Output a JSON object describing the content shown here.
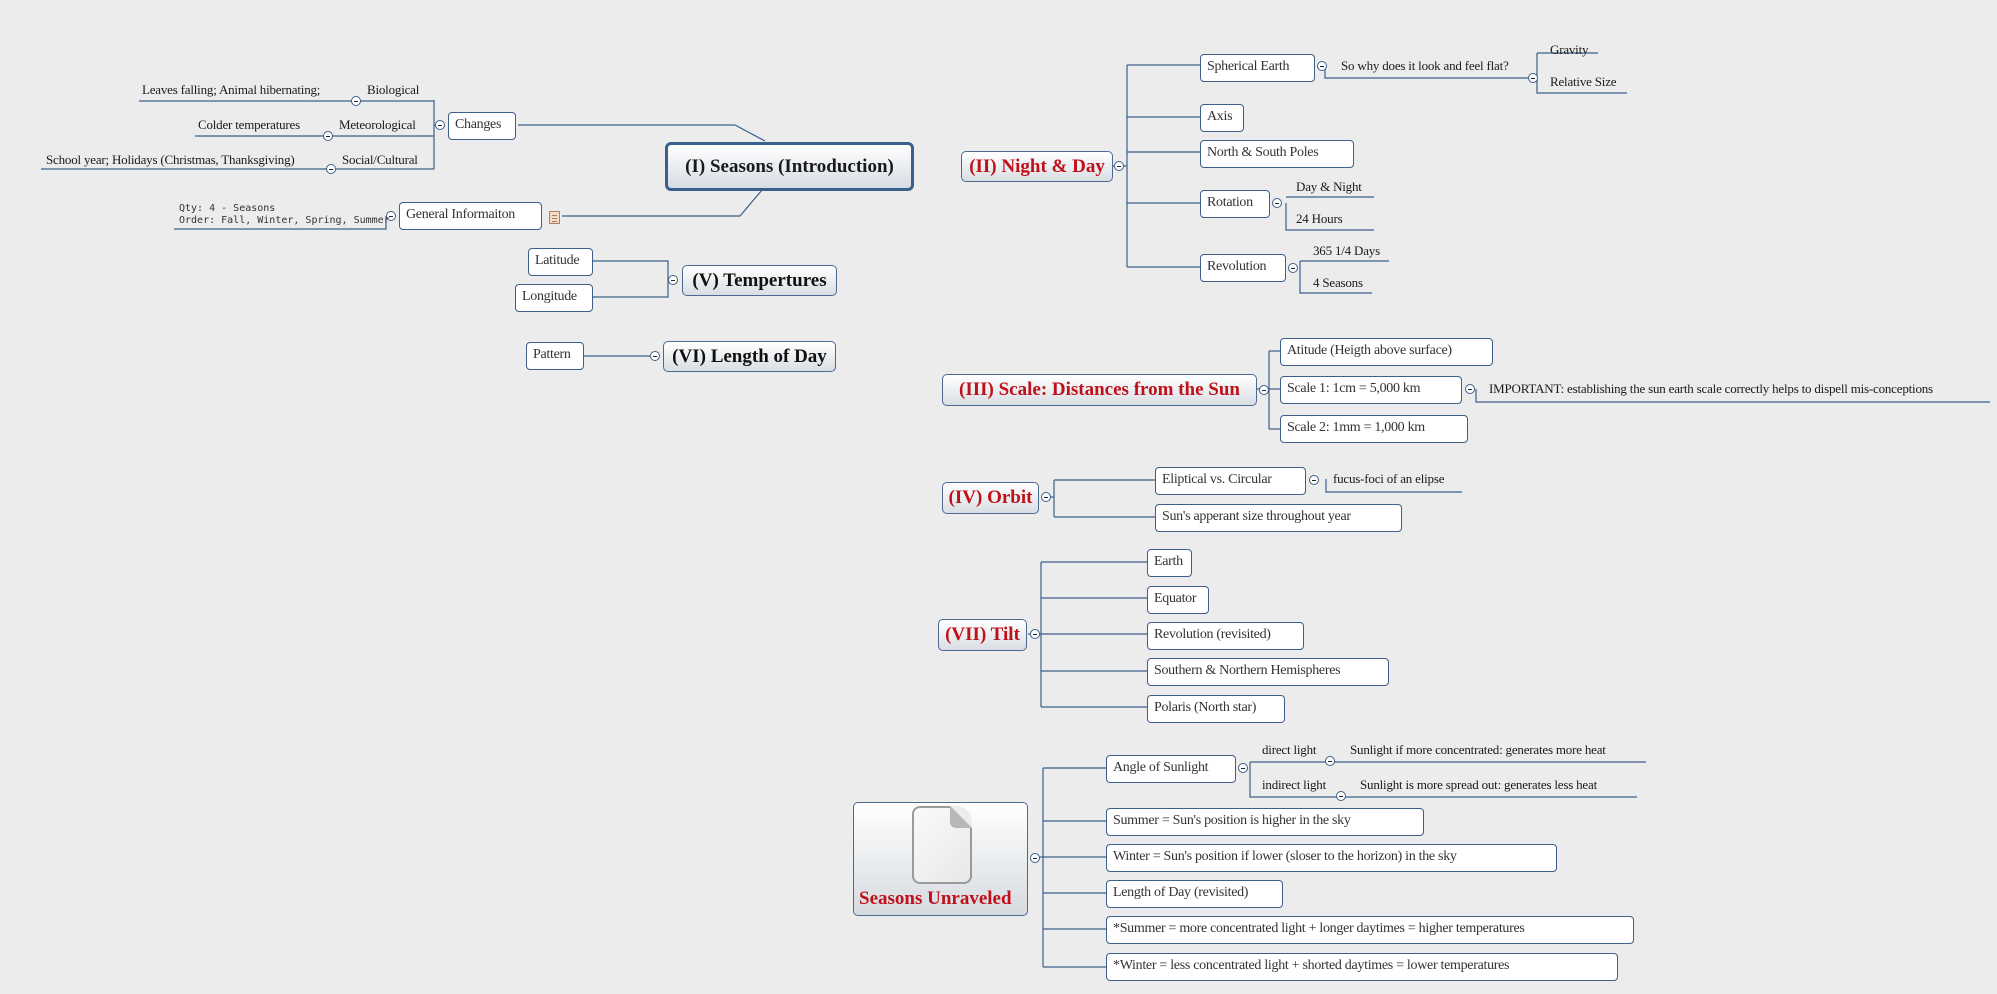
{
  "colors": {
    "topic_red": "#c0101a",
    "line_blue": "#3d5f8a",
    "background": "#ececec"
  },
  "central": {
    "title": "(I) Seasons (Introduction)"
  },
  "intro": {
    "changes": {
      "label": "Changes",
      "children": [
        {
          "label": "Biological",
          "detail": "Leaves falling; Animal hibernating;"
        },
        {
          "label": "Meteorological",
          "detail": "Colder temperatures"
        },
        {
          "label": "Social/Cultural",
          "detail": "School year; Holidays (Christmas, Thanksgiving)"
        }
      ]
    },
    "general": {
      "label": "General Informaiton",
      "note_lines": [
        "Qty: 4 - Seasons",
        "Order: Fall, Winter, Spring, Summer"
      ],
      "note_icon": "note-icon"
    }
  },
  "temperatures": {
    "title": "(V) Tempertures",
    "children": [
      "Latitude",
      "Longitude"
    ]
  },
  "length_of_day": {
    "title": "(VI) Length of Day",
    "children": [
      "Pattern"
    ]
  },
  "night_day": {
    "title": "(II) Night & Day",
    "spherical": {
      "label": "Spherical Earth",
      "question": "So why does it look and feel flat?",
      "answers": [
        "Gravity",
        "Relative Size"
      ]
    },
    "axis": "Axis",
    "poles": "North & South Poles",
    "rotation": {
      "label": "Rotation",
      "children": [
        "Day & Night",
        "24 Hours"
      ]
    },
    "revolution": {
      "label": "Revolution",
      "children": [
        "365 1/4 Days",
        "4 Seasons"
      ]
    }
  },
  "scale": {
    "title": "(III) Scale: Distances from the Sun",
    "children": [
      "Atitude (Heigth above surface)",
      "Scale 1: 1cm = 5,000 km",
      "Scale 2: 1mm = 1,000 km"
    ],
    "important": "IMPORTANT: establishing the sun earth scale correctly helps to dispell mis-conceptions"
  },
  "orbit": {
    "title": "(IV) Orbit",
    "elliptical": "Eliptical vs. Circular",
    "foci": "fucus-foci of an elipse",
    "apparent": "Sun's apperant size throughout year"
  },
  "tilt": {
    "title": "(VII) Tilt",
    "children": [
      "Earth",
      "Equator",
      "Revolution (revisited)",
      "Southern & Northern Hemispheres",
      "Polaris (North star)"
    ]
  },
  "unraveled": {
    "title": "Seasons Unraveled",
    "icon": "document-icon",
    "angle": {
      "label": "Angle of Sunlight",
      "direct": "direct light",
      "direct_detail": "Sunlight if more concentrated: generates more heat",
      "indirect": "indirect light",
      "indirect_detail": "Sunlight is more spread out: generates less heat"
    },
    "items": [
      "Summer = Sun's position is higher in the sky",
      "Winter = Sun's position if lower (sloser to the horizon) in the sky",
      "Length of Day (revisited)",
      "*Summer = more concentrated light + longer daytimes = higher temperatures",
      "*Winter = less concentrated light + shorted daytimes = lower temperatures"
    ]
  }
}
